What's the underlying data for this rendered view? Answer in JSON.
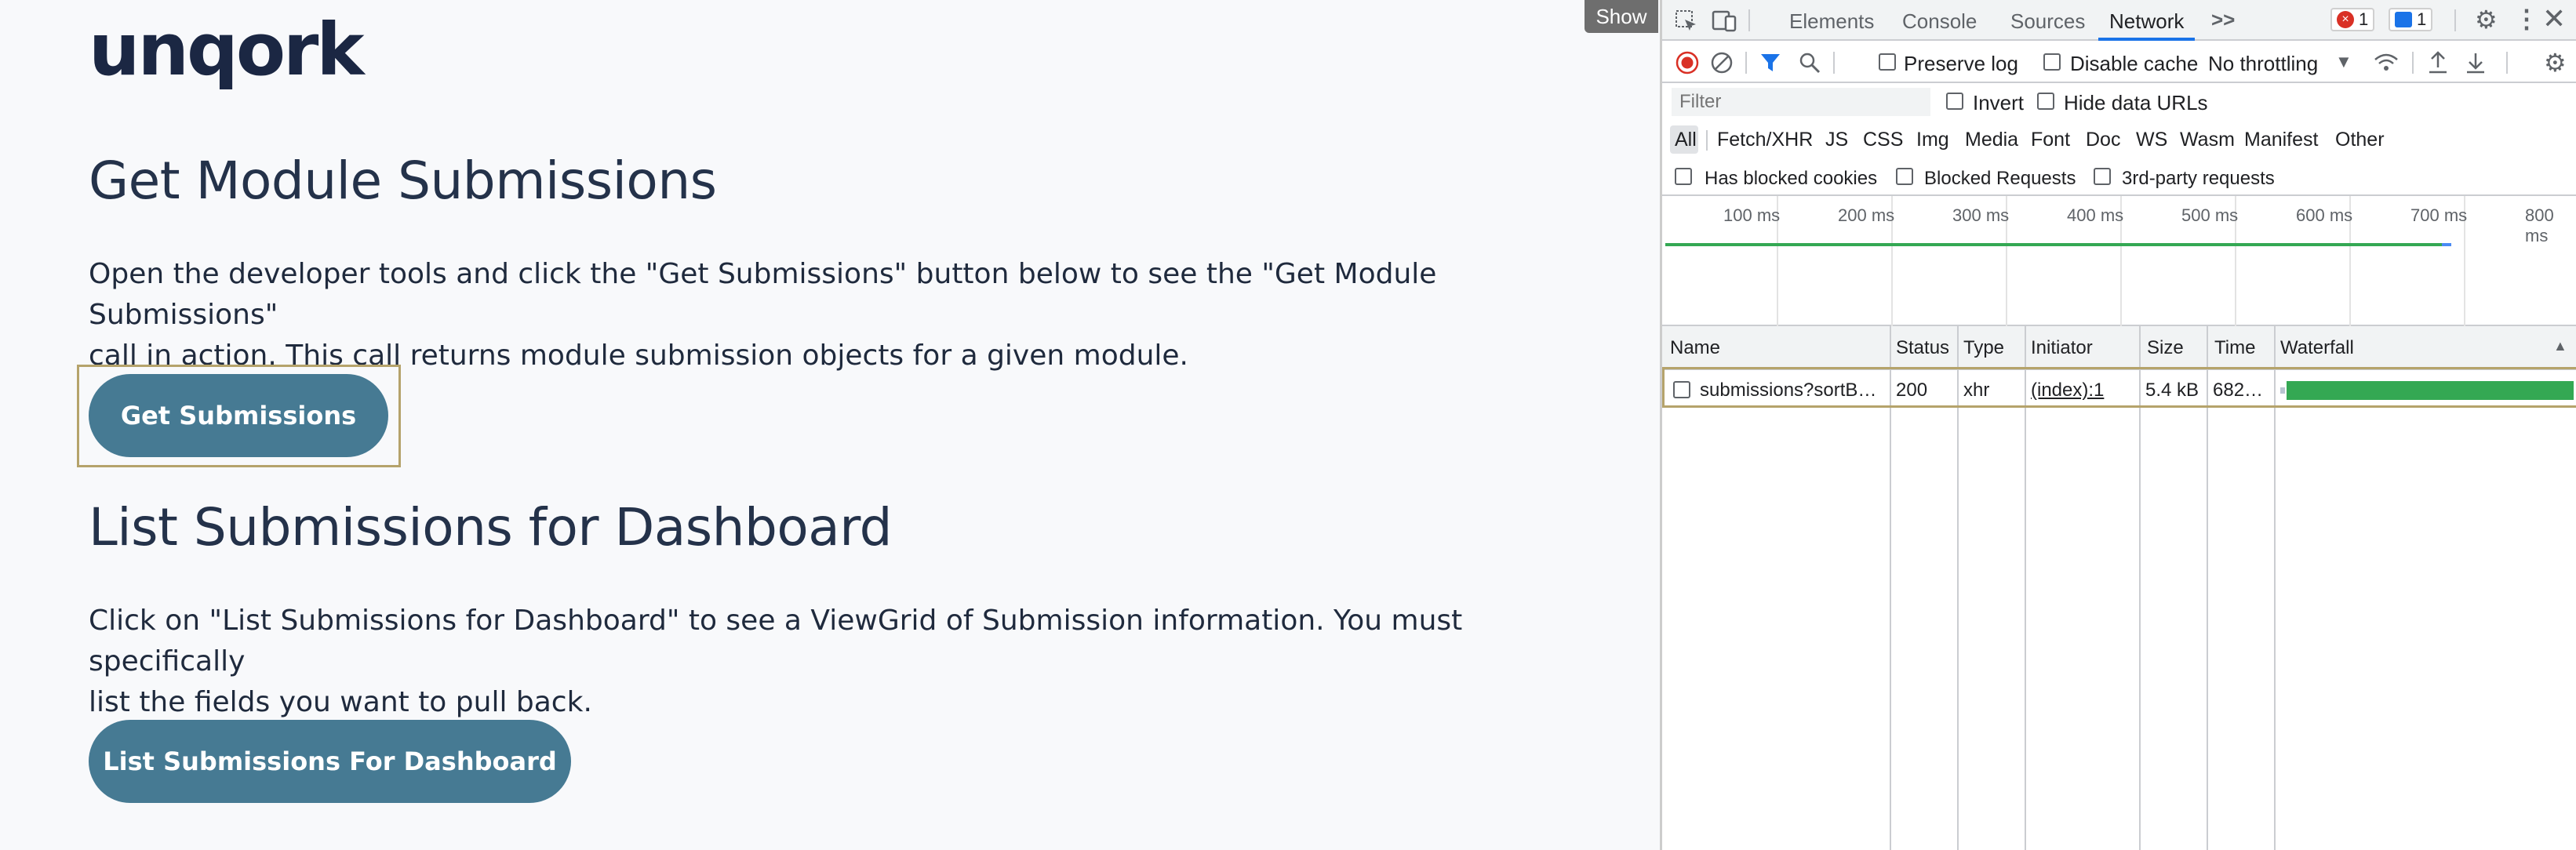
{
  "page": {
    "logo": "unqork",
    "section1": {
      "heading": "Get Module Submissions",
      "line1": "Open the developer tools and click the \"Get Submissions\" button below to see the \"Get Module Submissions\"",
      "line2": "call in action. This call returns module submission objects for a given module.",
      "button": "Get Submissions"
    },
    "section2": {
      "heading": "List Submissions for Dashboard",
      "line1": "Click on \"List Submissions for Dashboard\" to see a ViewGrid of Submission information. You must specifically",
      "line2": "list the fields you want to pull back.",
      "button": "List Submissions For Dashboard"
    },
    "show_tab": "Show"
  },
  "devtools": {
    "tabs": [
      "Elements",
      "Console",
      "Sources",
      "Network"
    ],
    "active_tab": "Network",
    "overflow_icon": ">>",
    "error_count": "1",
    "message_count": "1",
    "toolbar": {
      "preserve_log": "Preserve log",
      "disable_cache": "Disable cache",
      "throttling": "No throttling"
    },
    "filter": {
      "placeholder": "Filter",
      "invert": "Invert",
      "hide_data_urls": "Hide data URLs"
    },
    "types": [
      "All",
      "Fetch/XHR",
      "JS",
      "CSS",
      "Img",
      "Media",
      "Font",
      "Doc",
      "WS",
      "Wasm",
      "Manifest",
      "Other"
    ],
    "extra_filters": {
      "blocked_cookies": "Has blocked cookies",
      "blocked_requests": "Blocked Requests",
      "third_party": "3rd-party requests"
    },
    "timeline_ticks": [
      "100 ms",
      "200 ms",
      "300 ms",
      "400 ms",
      "500 ms",
      "600 ms",
      "700 ms",
      "800 ms"
    ],
    "columns": [
      "Name",
      "Status",
      "Type",
      "Initiator",
      "Size",
      "Time",
      "Waterfall"
    ],
    "rows": [
      {
        "name": "submissions?sortB…",
        "status": "200",
        "type": "xhr",
        "initiator": "(index):1",
        "size": "5.4 kB",
        "time": "682…"
      }
    ],
    "colors": {
      "accent": "#1a73e8",
      "waterfall": "#34a853",
      "button": "#467a93"
    }
  }
}
